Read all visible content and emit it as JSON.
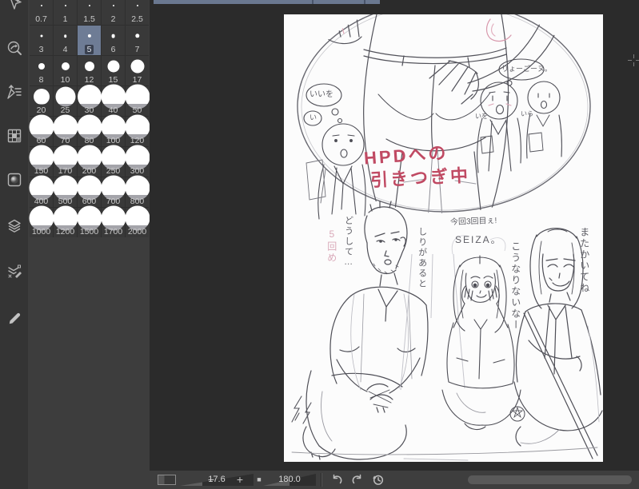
{
  "icons": {
    "sidebar": [
      "operation-tool",
      "navigate-zoom",
      "export-pen",
      "color-swatches",
      "gradient-tile",
      "layers",
      "layer-property",
      "pen"
    ],
    "bottombar": [
      "undo",
      "redo",
      "history"
    ]
  },
  "brush_palette": {
    "sizes": [
      "0.7",
      "1",
      "1.5",
      "2",
      "2.5",
      "3",
      "4",
      "5",
      "6",
      "7",
      "8",
      "10",
      "12",
      "15",
      "17",
      "20",
      "25",
      "30",
      "40",
      "50",
      "60",
      "70",
      "80",
      "100",
      "120",
      "150",
      "170",
      "200",
      "250",
      "300",
      "400",
      "500",
      "600",
      "700",
      "800",
      "1000",
      "1200",
      "1500",
      "1700",
      "2000"
    ],
    "selected_size": "5"
  },
  "statusbar": {
    "zoom_value": "17.6",
    "rotation_value": "180.0",
    "minus_label": "−",
    "plus_label": "+",
    "stop_label": "■"
  },
  "canvas": {
    "annotations": {
      "red_line1": "HPDへの",
      "red_line2": "引きつぎ中",
      "bubble_left": "いいを",
      "bubble_left_small": "い",
      "bubble_right": "りょーごーヌ。",
      "chibi_label_1": "いを",
      "chibi_label_2": "いら",
      "note_doushite": "どうして…",
      "note_pink": "5回め",
      "note_shiri": "しりがあると",
      "note_konkai": "今回3回目ぇ!",
      "note_seiza": "SEIZA。",
      "note_kou": "こうなりないなー",
      "note_mata": "またかいてね"
    }
  }
}
